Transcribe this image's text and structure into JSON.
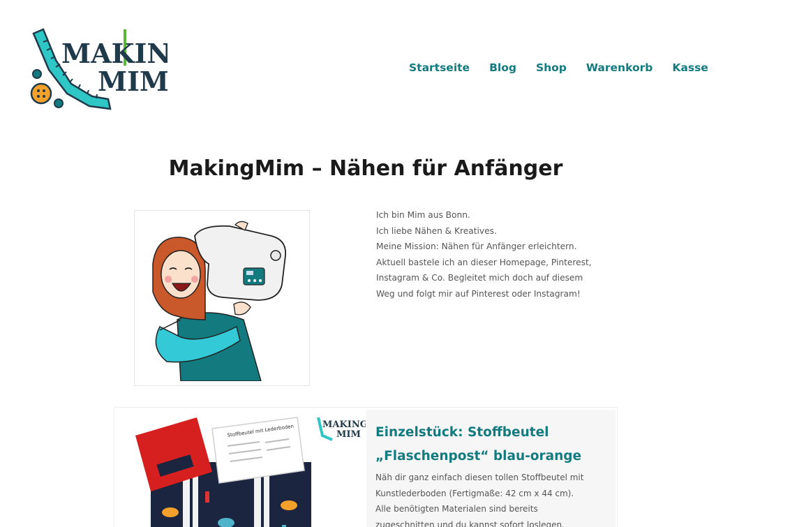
{
  "brand": {
    "logo_line1": "MAKING",
    "logo_line2": "MIM"
  },
  "nav": {
    "items": [
      "Startseite",
      "Blog",
      "Shop",
      "Warenkorb",
      "Kasse"
    ]
  },
  "page": {
    "title": "MakingMim – Nähen für Anfänger"
  },
  "intro": {
    "lines": [
      "Ich bin Mim aus Bonn.",
      "Ich liebe Nähen & Kreatives.",
      "Meine Mission: Nähen für Anfänger erleichtern.",
      "Aktuell bastele ich an dieser Homepage, Pinterest,",
      "Instagram & Co. Begleitet mich doch auf diesem",
      "Weg und folgt mir auf Pinterest oder Instagram!"
    ]
  },
  "product": {
    "title_line1": "Einzelstück: Stoffbeutel",
    "title_line2": "„Flaschenpost“ blau-orange",
    "desc_lines": [
      "Näh dir ganz einfach diesen tollen Stoffbeutel mit",
      "Kunstlederboden (Fertigmaße: 42 cm x 44 cm).",
      "Alle benötigten Materialen sind bereits",
      "zugeschnitten und du kannst sofort loslegen."
    ],
    "image_logo_line1": "MAKING",
    "image_logo_line2": "MIM",
    "image_card_title": "Stoffbeutel mit Lederboden"
  },
  "colors": {
    "accent": "#137b80",
    "title": "#1a1a1a",
    "body": "#555555",
    "logo_teal": "#2fc6c6",
    "logo_orange": "#f4a12c"
  }
}
